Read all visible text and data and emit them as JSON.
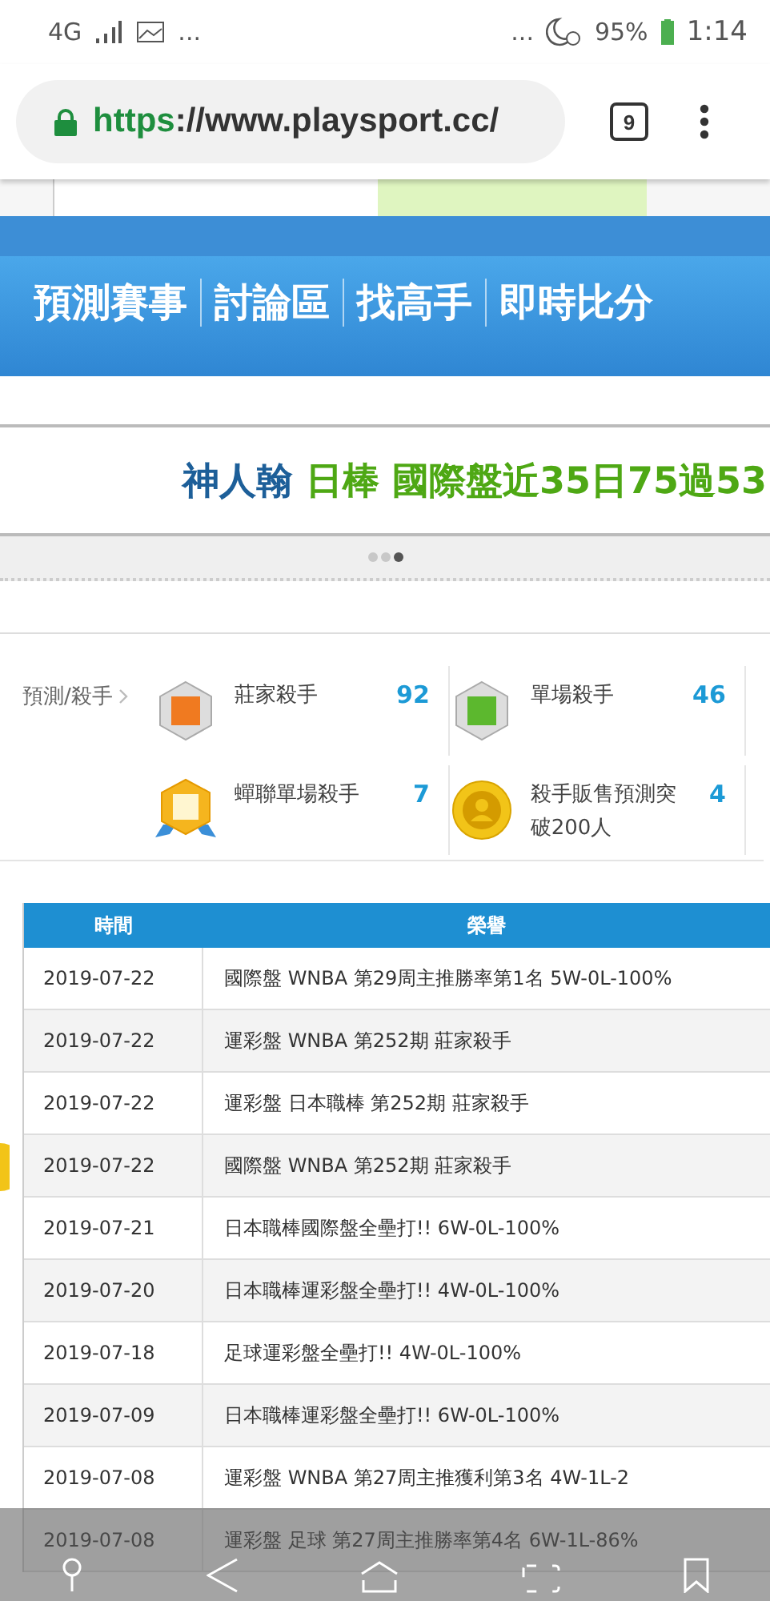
{
  "status_bar": {
    "network": "4G",
    "dots_left": "...",
    "dots_right": "...",
    "battery": "95%",
    "time": "1:14"
  },
  "browser": {
    "url_scheme": "https",
    "url_rest": "://www.playsport.cc/",
    "tab_count": "9"
  },
  "nav": {
    "items": [
      "預測賽事",
      "討論區",
      "找高手",
      "即時比分"
    ]
  },
  "banner": {
    "name": "神人翰",
    "headline": "日棒 國際盤近35日75過53",
    "dots": [
      {
        "selected": false
      },
      {
        "selected": false
      },
      {
        "selected": true
      }
    ]
  },
  "honors": {
    "label": "預測/殺手",
    "items": [
      {
        "kind": "house",
        "name": "莊家殺手",
        "count": "92"
      },
      {
        "kind": "single",
        "name": "單場殺手",
        "count": "46"
      },
      {
        "kind": "ribbon",
        "name": "蟬聯單場殺手",
        "count": "7"
      },
      {
        "kind": "coin",
        "name": "殺手販售預測突破200人",
        "count": "4"
      }
    ]
  },
  "table": {
    "columns": [
      "時間",
      "榮譽"
    ],
    "rows": [
      [
        "2019-07-22",
        "國際盤 WNBA 第29周主推勝率第1名 5W-0L-100%"
      ],
      [
        "2019-07-22",
        "運彩盤 WNBA 第252期 莊家殺手"
      ],
      [
        "2019-07-22",
        "運彩盤 日本職棒 第252期 莊家殺手"
      ],
      [
        "2019-07-22",
        "國際盤 WNBA 第252期 莊家殺手"
      ],
      [
        "2019-07-21",
        "日本職棒國際盤全壘打!! 6W-0L-100%"
      ],
      [
        "2019-07-20",
        "日本職棒運彩盤全壘打!! 4W-0L-100%"
      ],
      [
        "2019-07-18",
        "足球運彩盤全壘打!! 4W-0L-100%"
      ],
      [
        "2019-07-09",
        "日本職棒運彩盤全壘打!! 6W-0L-100%"
      ],
      [
        "2019-07-08",
        "運彩盤 WNBA 第27周主推獲利第3名 4W-1L-2"
      ],
      [
        "2019-07-08",
        "運彩盤 足球 第27周主推勝率第4名 6W-1L-86%"
      ]
    ]
  }
}
